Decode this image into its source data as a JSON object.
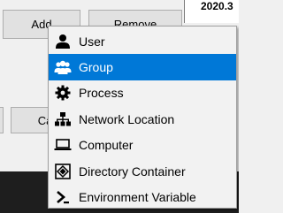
{
  "dialog": {
    "add_label": "Add",
    "remove_label": "Remove",
    "cancel_label": "Ca",
    "version_text": "2020.3"
  },
  "menu": {
    "items": [
      {
        "label": "User",
        "icon": "user-icon"
      },
      {
        "label": "Group",
        "icon": "group-icon",
        "selected": true
      },
      {
        "label": "Process",
        "icon": "gear-icon"
      },
      {
        "label": "Network Location",
        "icon": "network-icon"
      },
      {
        "label": "Computer",
        "icon": "computer-icon"
      },
      {
        "label": "Directory Container",
        "icon": "directory-container-icon"
      },
      {
        "label": "Environment Variable",
        "icon": "environment-variable-icon"
      }
    ],
    "highlight_color": "#0078d7"
  }
}
